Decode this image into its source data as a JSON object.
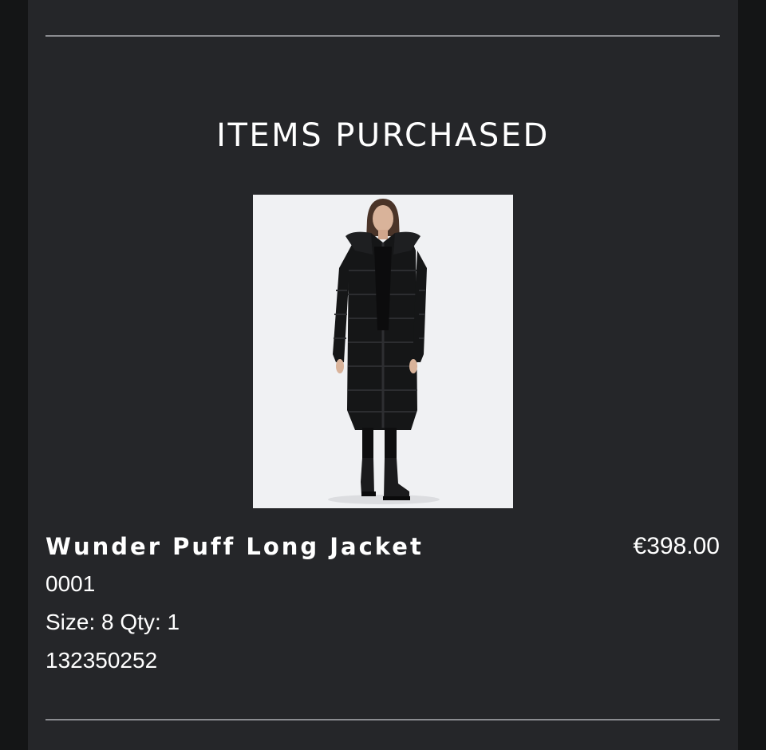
{
  "section": {
    "title": "ITEMS PURCHASED"
  },
  "item": {
    "name": "Wunder Puff Long Jacket",
    "price": "€398.00",
    "style_code": "0001",
    "size_label": "Size:",
    "size": "8",
    "qty_label": "Qty:",
    "qty": "1",
    "item_number": "132350252",
    "image": {
      "subject": "model wearing long black puffer jacket",
      "background_color": "#f0f1f3",
      "garment_color": "#151617"
    }
  },
  "theme": {
    "page_bg": "#141516",
    "card_bg": "#252629",
    "divider": "#8b8c90",
    "text": "#ffffff"
  }
}
